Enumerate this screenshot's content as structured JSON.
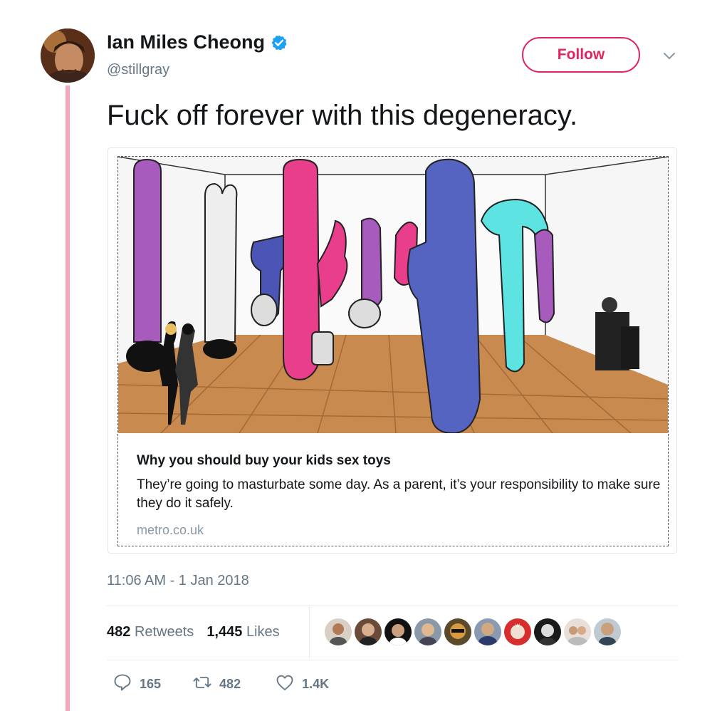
{
  "tweet": {
    "author_name": "Ian Miles Cheong",
    "author_handle": "@stillgray",
    "follow_label": "Follow",
    "text": "Fuck off forever with this degeneracy.",
    "timestamp": "11:06 AM - 1 Jan 2018"
  },
  "card": {
    "title": "Why you should buy your kids sex toys",
    "description": "They’re going to masturbate some day. As a parent, it’s your responsibility to make sure they do it safely.",
    "domain": "metro.co.uk"
  },
  "stats": {
    "retweets_count": "482",
    "retweets_label": "Retweets",
    "likes_count": "1,445",
    "likes_label": "Likes"
  },
  "actions": {
    "reply_count": "165",
    "retweet_count": "482",
    "like_count": "1.4K"
  },
  "colors": {
    "accent": "#e0245e",
    "verified": "#1da1f2",
    "thread_line": "#f3a8bc",
    "muted": "#657786"
  },
  "icons": [
    "verified-badge-icon",
    "chevron-down-icon",
    "reply-icon",
    "retweet-icon",
    "heart-icon"
  ]
}
